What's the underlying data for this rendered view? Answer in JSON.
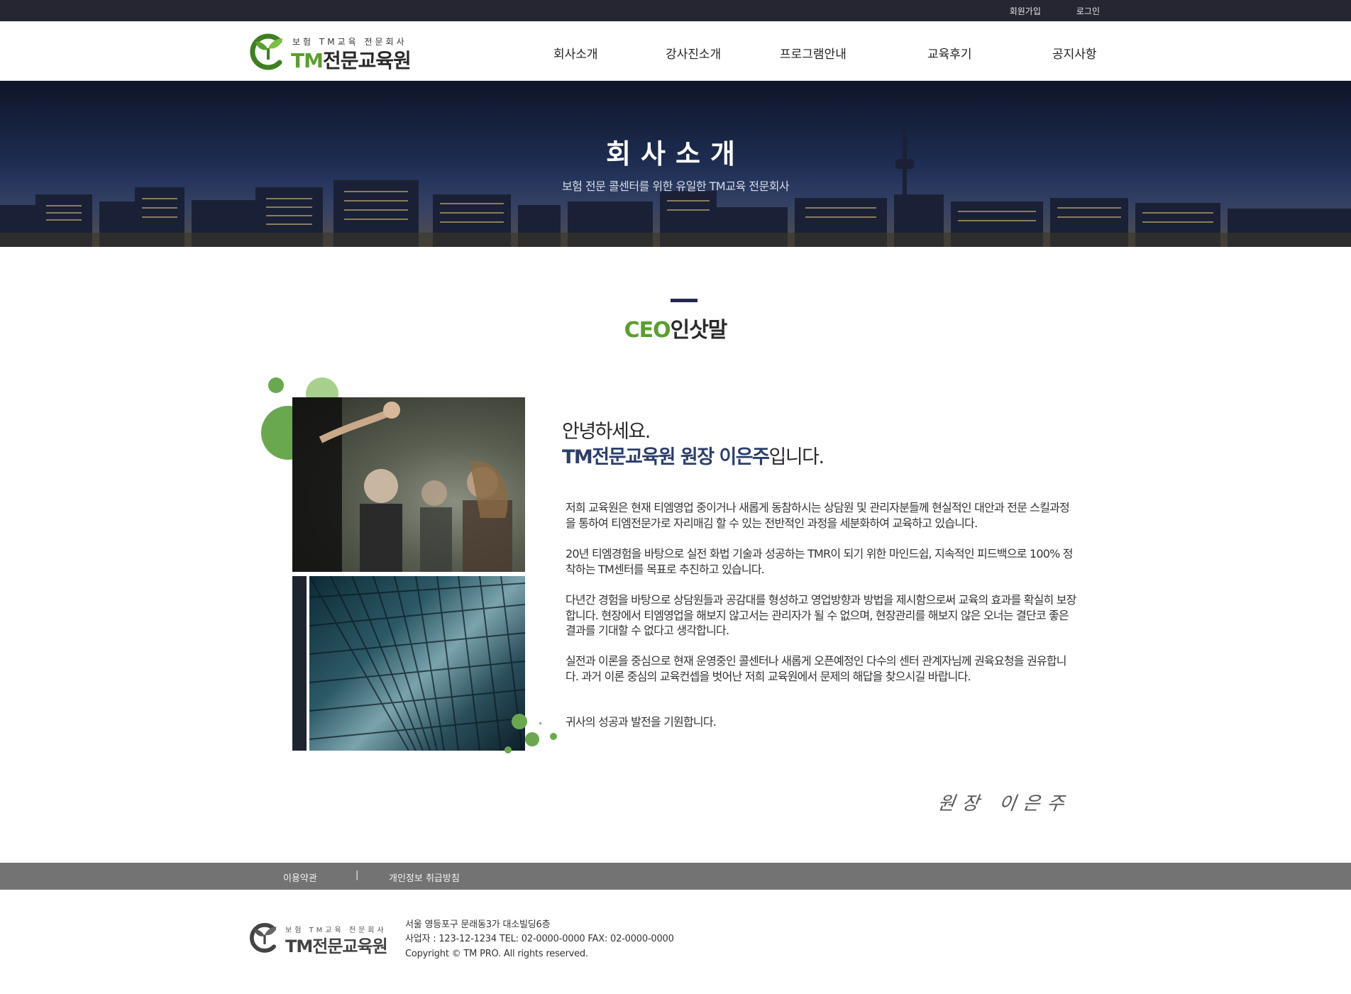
{
  "topbar": {
    "signup": "회원가입",
    "login": "로그인"
  },
  "logo": {
    "tagline": "보험 TM교육 전문회사",
    "brand_tm": "TM",
    "brand_name": "전문교육원"
  },
  "nav": [
    "회사소개",
    "강사진소개",
    "프로그램안내",
    "교육후기",
    "공지사항"
  ],
  "hero": {
    "title": "회사소개",
    "subtitle": "보험 전문 콜센터를 위한 유일한 TM교육 전문회사"
  },
  "section": {
    "title_accent": "CEO",
    "title_rest": "인삿말"
  },
  "message": {
    "greeting_line1": "안녕하세요.",
    "greeting_highlight": "TM전문교육원 원장 이은주",
    "greeting_suffix": "입니다.",
    "paragraphs": [
      "저희 교육원은 현재 티엠영업 중이거나 새롭게 동참하시는 상담원 및 관리자분들께 현실적인 대안과 전문 스킬과정을 통하여 티엠전문가로 자리매김 할 수 있는 전반적인 과정을 세분화하여 교육하고 있습니다.",
      "20년 티엠경험을 바탕으로 실전 화법 기술과 성공하는 TMR이 되기 위한 마인드쉽, 지속적인 피드백으로 100% 정착하는 TM센터를 목표로 추진하고 있습니다.",
      "다년간 경험을 바탕으로 상담원들과 공감대를 형성하고 영업방향과 방법을 제시함으로써 교육의 효과를 확실히 보장합니다. 현장에서 티엠영업을 해보지 않고서는 관리자가 될 수 없으며, 현장관리를 해보지 않은 오너는 결단코 좋은 결과를 기대할 수 없다고 생각합니다.",
      "실전과 이론을 중심으로 현재 운영중인 콜센터나 새롭게 오픈예정인 다수의 센터 관계자님께 권육요청을 권유합니다. 과거 이론 중심의 교육컨셉을 벗어난 저희 교육원에서 문제의 해답을 찾으시길 바랍니다.",
      "귀사의 성공과 발전을 기원합니다."
    ],
    "signature": "원장 이은주"
  },
  "footer": {
    "terms": "이용약관",
    "separator": "|",
    "privacy": "개인정보 취급방침",
    "tagline": "보험 TM교육 전문회사",
    "brand": "TM전문교육원",
    "address": "서울 영등포구 문래동3가 대소빌딩6층",
    "business": "사업자 : 123-12-1234 TEL: 02-0000-0000 FAX: 02-0000-0000",
    "copyright": "Copyright © TM PRO. All rights reserved."
  },
  "colors": {
    "accent_green": "#5a9f2e",
    "navy": "#2b3e6b",
    "topbar": "#262633",
    "footbar": "#737373"
  }
}
